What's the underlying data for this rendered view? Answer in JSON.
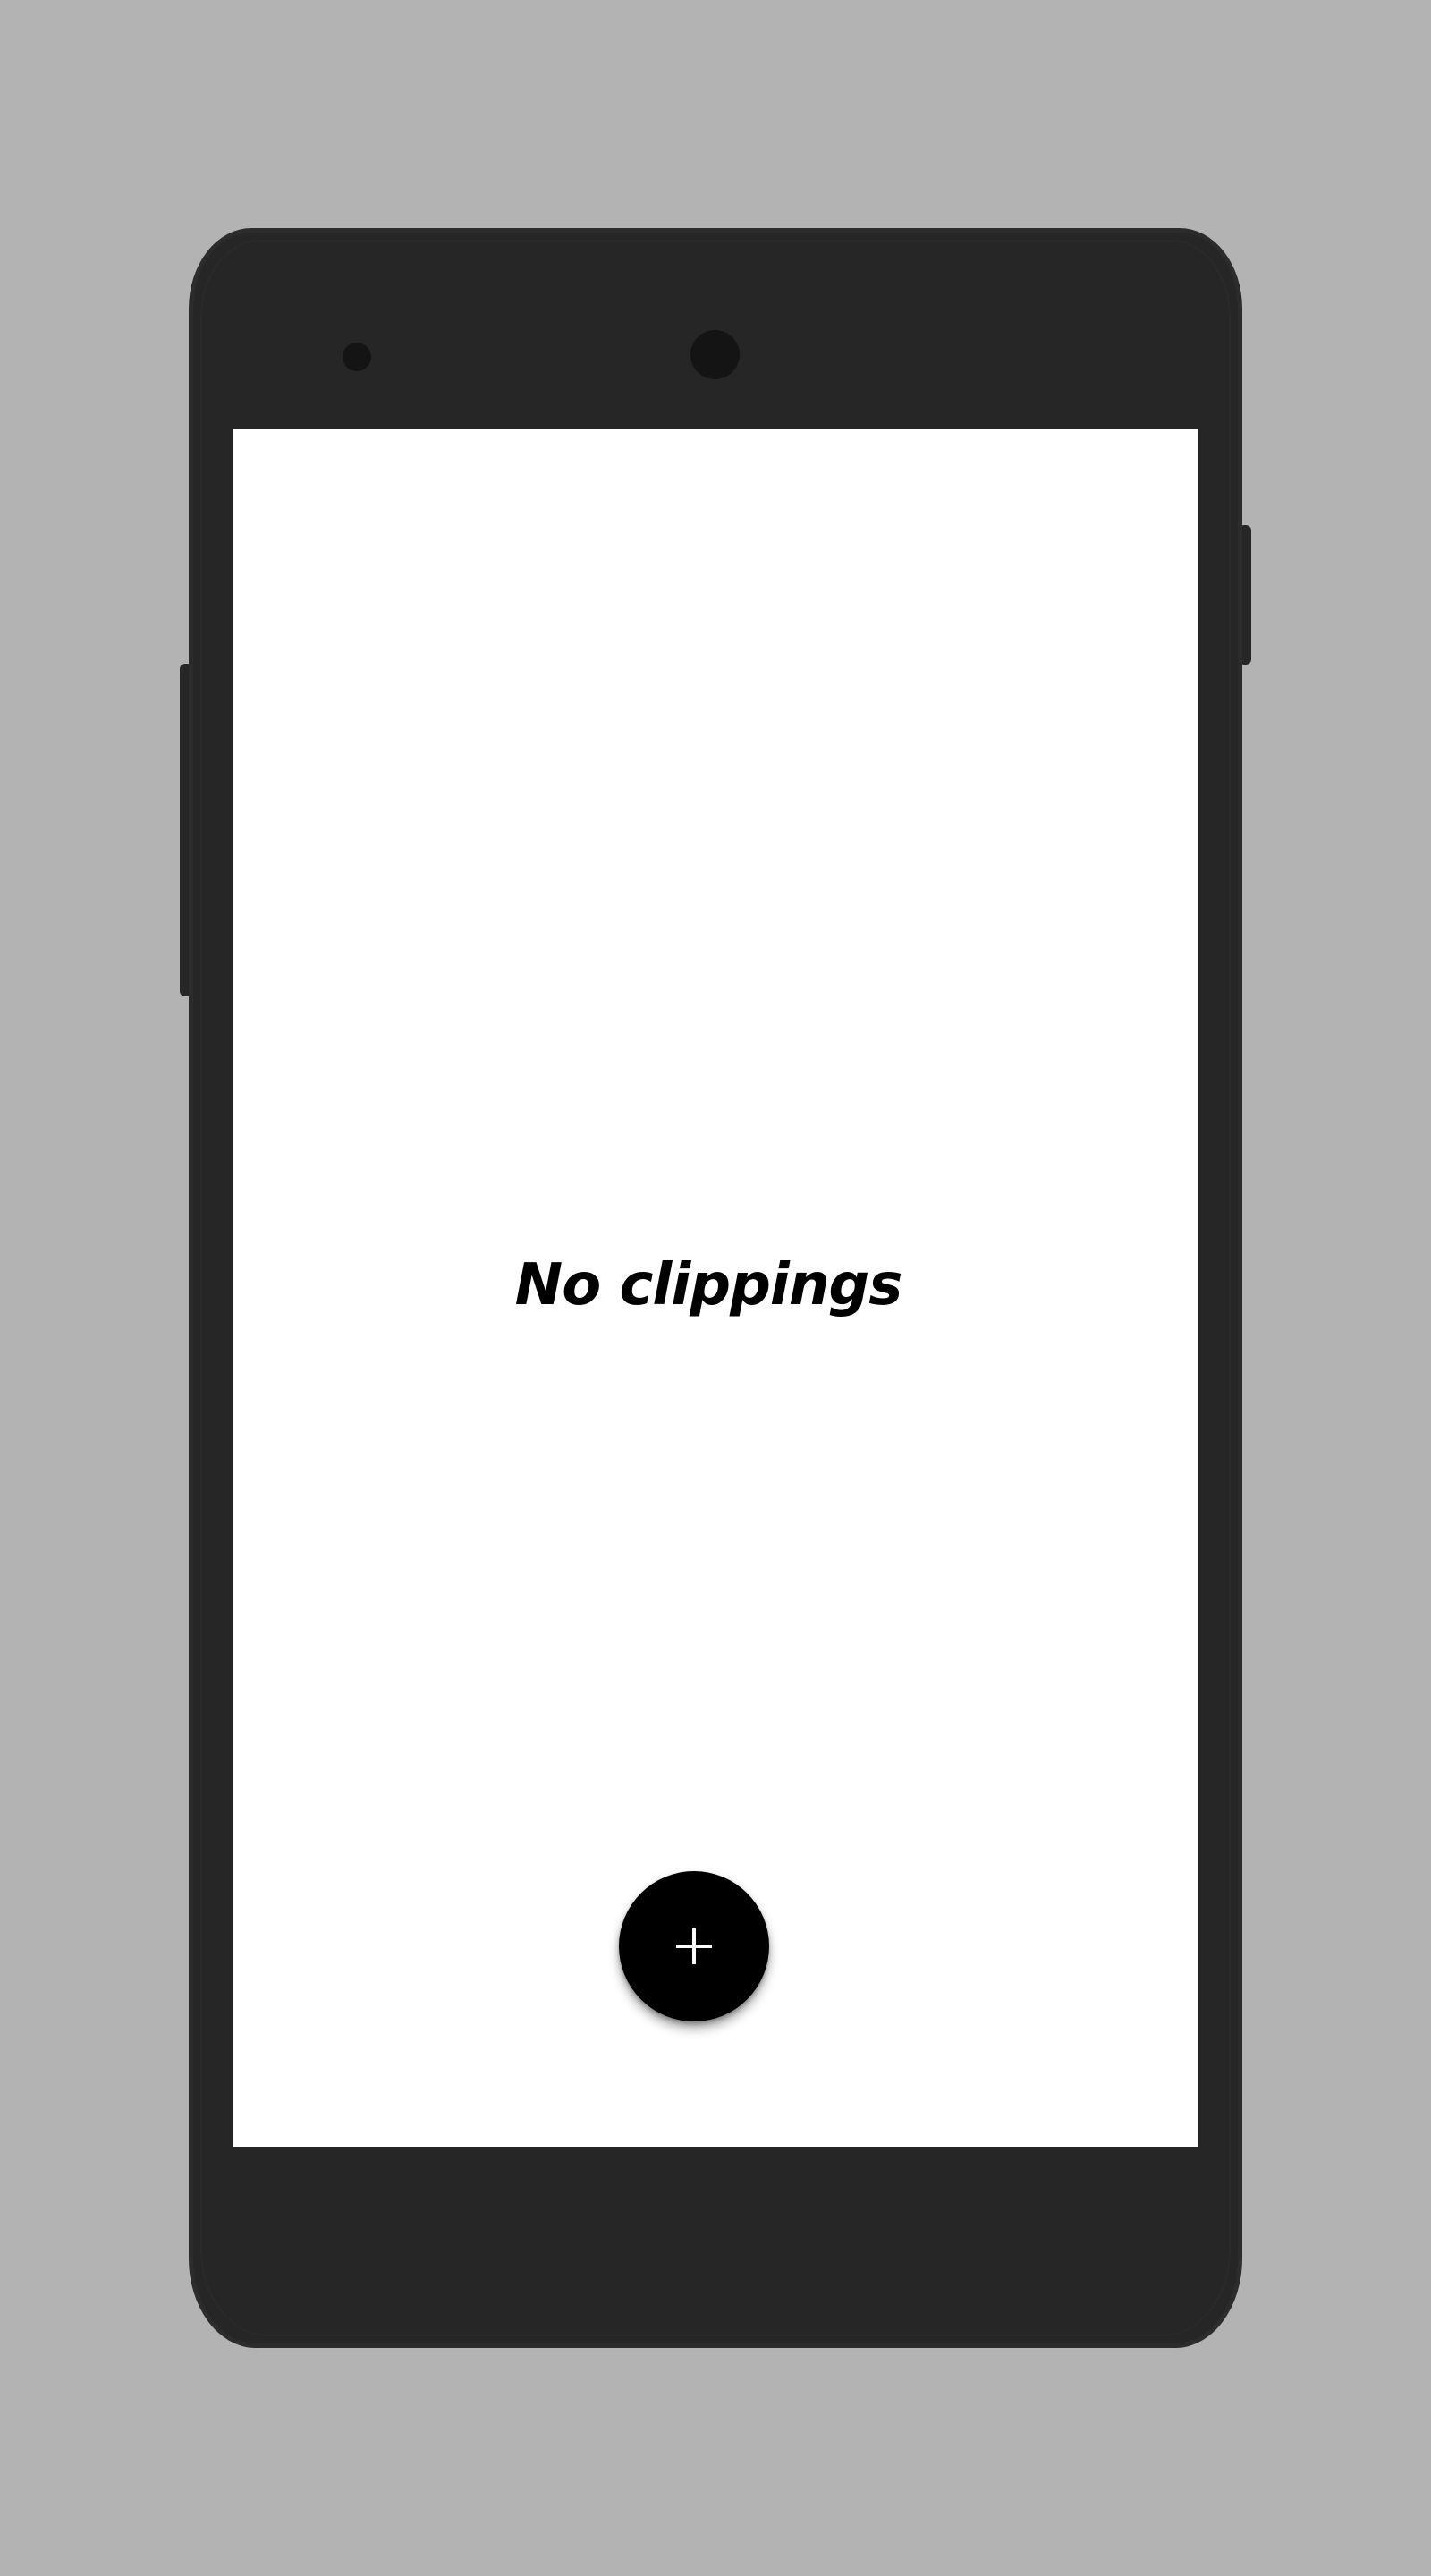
{
  "screen": {
    "empty_message": "No clippings"
  },
  "fab": {
    "icon": "plus-icon",
    "color": "#000000",
    "icon_color": "#ffffff"
  },
  "device": {
    "frame_color": "#262626",
    "background_color": "#b3b3b3"
  }
}
